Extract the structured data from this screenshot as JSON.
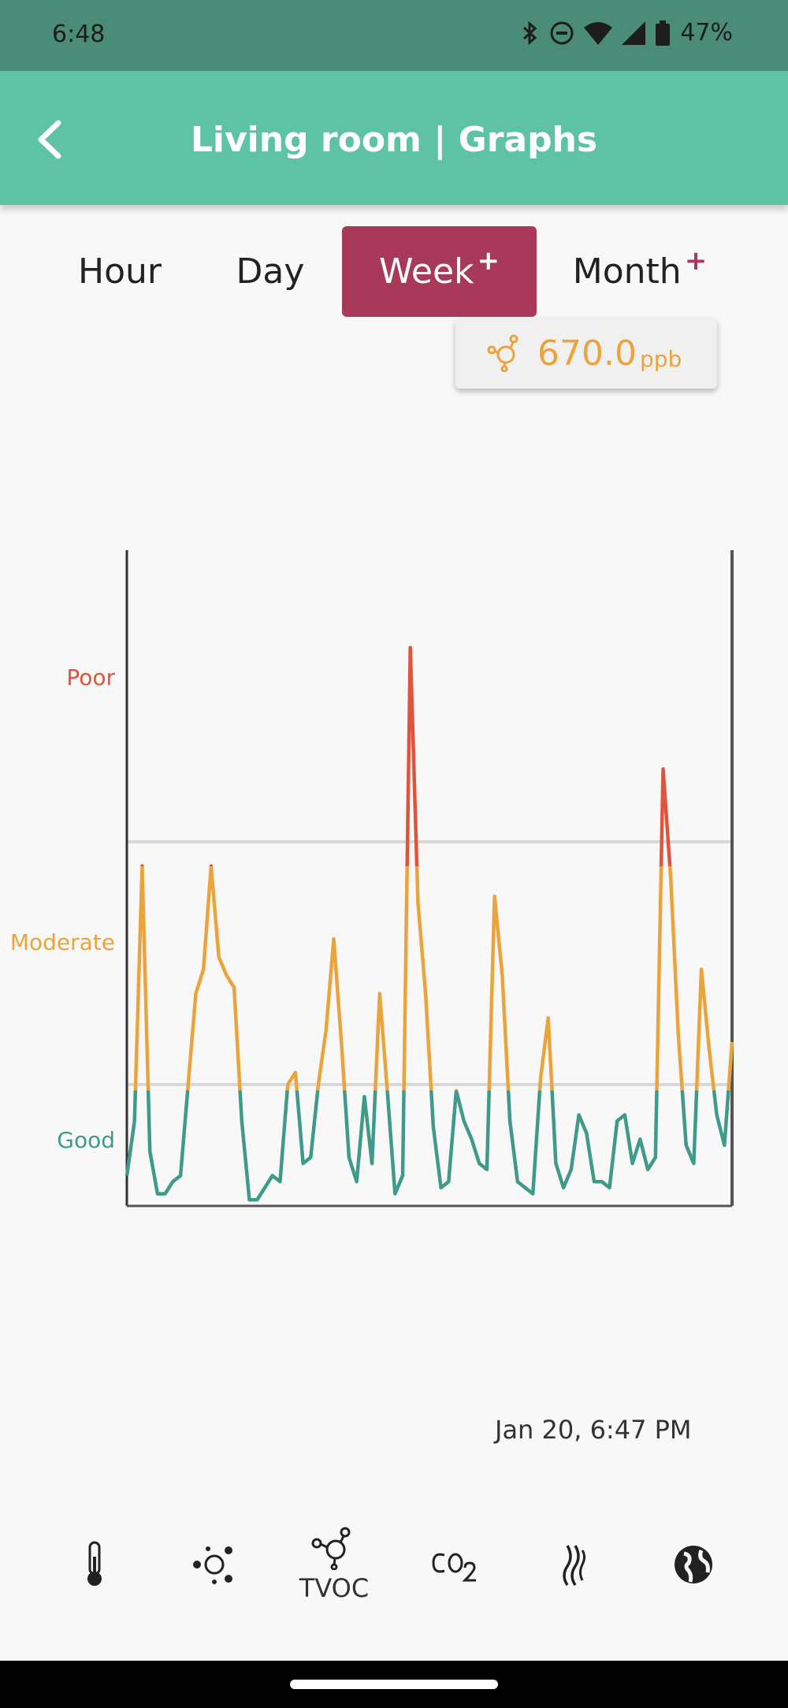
{
  "status_bar": {
    "time": "6:48",
    "battery": "47%"
  },
  "app_bar": {
    "title": "Living room | Graphs"
  },
  "tabs": [
    {
      "label": "Hour",
      "active": false,
      "plus": ""
    },
    {
      "label": "Day",
      "active": false,
      "plus": ""
    },
    {
      "label": "Week",
      "active": true,
      "plus": "+"
    },
    {
      "label": "Month",
      "active": false,
      "plus": "+"
    }
  ],
  "tooltip": {
    "value": "670.0",
    "unit": "ppb",
    "icon": "tvoc-icon"
  },
  "chart_data": {
    "type": "line",
    "title": "",
    "levels": [
      {
        "name": "Poor",
        "color": "#e0533c"
      },
      {
        "name": "Moderate",
        "color": "#eba33c"
      },
      {
        "name": "Good",
        "color": "#3f9a8a"
      }
    ],
    "y_scale": "air quality level (Good < Moderate < Poor)",
    "series": [
      {
        "values": [
          0.05,
          0.14,
          0.56,
          0.09,
          0.02,
          0.02,
          0.04,
          0.05,
          0.2,
          0.35,
          0.39,
          0.56,
          0.41,
          0.38,
          0.36,
          0.14,
          0.01,
          0.01,
          0.03,
          0.05,
          0.04,
          0.2,
          0.22,
          0.07,
          0.08,
          0.2,
          0.29,
          0.44,
          0.27,
          0.08,
          0.04,
          0.18,
          0.07,
          0.35,
          0.19,
          0.02,
          0.05,
          0.92,
          0.5,
          0.35,
          0.13,
          0.03,
          0.04,
          0.19,
          0.14,
          0.11,
          0.07,
          0.06,
          0.51,
          0.38,
          0.14,
          0.04,
          0.03,
          0.02,
          0.21,
          0.31,
          0.07,
          0.03,
          0.06,
          0.15,
          0.12,
          0.04,
          0.04,
          0.03,
          0.14,
          0.15,
          0.07,
          0.11,
          0.06,
          0.08,
          0.72,
          0.54,
          0.28,
          0.1,
          0.07,
          0.39,
          0.26,
          0.15,
          0.1,
          0.27
        ]
      }
    ],
    "thresholds": {
      "good_moderate": 0.2,
      "moderate_poor": 0.6
    },
    "x_range": "one week",
    "grid": "two horizontal lines at level boundaries"
  },
  "timestamp": "Jan 20, 6:47 PM",
  "bottom_nav": [
    {
      "icon": "thermometer-icon",
      "label": ""
    },
    {
      "icon": "particles-icon",
      "label": ""
    },
    {
      "icon": "tvoc-icon",
      "label": "TVOC"
    },
    {
      "icon": "co2-icon",
      "label": ""
    },
    {
      "icon": "smoke-icon",
      "label": ""
    },
    {
      "icon": "globe-icon",
      "label": ""
    }
  ],
  "colors": {
    "teal": "#5ec2a4",
    "accent": "#a8395a",
    "orange": "#eba33c",
    "red": "#e0533c",
    "green": "#3f9a8a"
  }
}
